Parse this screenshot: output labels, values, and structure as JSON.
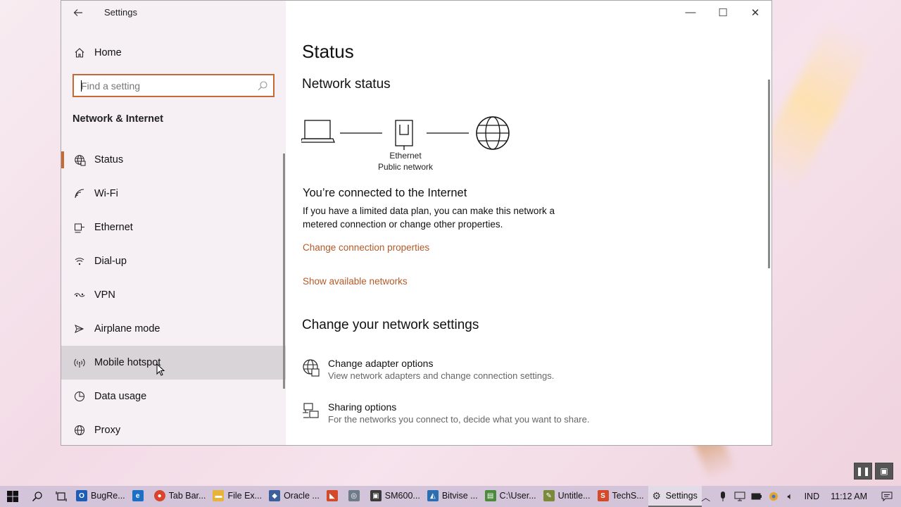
{
  "window": {
    "title": "Settings",
    "controls": {
      "minimize": "—",
      "maximize": "☐",
      "close": "✕"
    }
  },
  "sidebar": {
    "home_label": "Home",
    "search_placeholder": "Find a setting",
    "section_heading": "Network & Internet",
    "items": [
      {
        "label": "Status",
        "icon": "globe-network-icon",
        "active": true
      },
      {
        "label": "Wi-Fi",
        "icon": "wifi-icon"
      },
      {
        "label": "Ethernet",
        "icon": "ethernet-icon"
      },
      {
        "label": "Dial-up",
        "icon": "dialup-icon"
      },
      {
        "label": "VPN",
        "icon": "vpn-icon"
      },
      {
        "label": "Airplane mode",
        "icon": "airplane-icon"
      },
      {
        "label": "Mobile hotspot",
        "icon": "hotspot-icon",
        "hover": true
      },
      {
        "label": "Data usage",
        "icon": "data-usage-icon"
      },
      {
        "label": "Proxy",
        "icon": "proxy-globe-icon"
      }
    ]
  },
  "content": {
    "page_title": "Status",
    "network_status_heading": "Network status",
    "diagram": {
      "line1": "Ethernet",
      "line2": "Public network"
    },
    "connected_title": "You’re connected to the Internet",
    "connected_desc": "If you have a limited data plan, you can make this network a metered connection or change other properties.",
    "link_change_properties": "Change connection properties",
    "link_show_networks": "Show available networks",
    "change_settings_heading": "Change your network settings",
    "options": [
      {
        "title": "Change adapter options",
        "desc": "View network adapters and change connection settings.",
        "icon": "adapter-globe-icon"
      },
      {
        "title": "Sharing options",
        "desc": "For the networks you connect to, decide what you want to share.",
        "icon": "sharing-icon"
      }
    ]
  },
  "taskbar": {
    "apps": [
      {
        "label": "BugRe...",
        "color": "#1e5db5",
        "glyph": "O"
      },
      {
        "label": "",
        "color": "#1b6fc4",
        "glyph": "e"
      },
      {
        "label": "Tab Bar...",
        "color": "#d8442c",
        "glyph": "●"
      },
      {
        "label": "File Ex...",
        "color": "#e8b33a",
        "glyph": "▬"
      },
      {
        "label": "Oracle ...",
        "color": "#3a5f9c",
        "glyph": "◆"
      },
      {
        "label": "",
        "color": "#d24a2a",
        "glyph": "◣"
      },
      {
        "label": "",
        "color": "#6e7b8a",
        "glyph": "◎"
      },
      {
        "label": "SM600...",
        "color": "#3a3a3a",
        "glyph": "▣"
      },
      {
        "label": "Bitvise ...",
        "color": "#2b6fb3",
        "glyph": "◭"
      },
      {
        "label": "C:\\User...",
        "color": "#4a8a3a",
        "glyph": "▤"
      },
      {
        "label": "Untitle...",
        "color": "#7a8a3a",
        "glyph": "✎"
      },
      {
        "label": "TechS...",
        "color": "#d44a2a",
        "glyph": "S"
      },
      {
        "label": "Settings",
        "color": "#555555",
        "glyph": "⚙",
        "active": true
      }
    ],
    "tray": {
      "language": "IND",
      "time": "11:12 AM"
    }
  },
  "colors": {
    "accent": "#c56a33",
    "link": "#b45a28",
    "taskbar": "#d3c4d9"
  }
}
